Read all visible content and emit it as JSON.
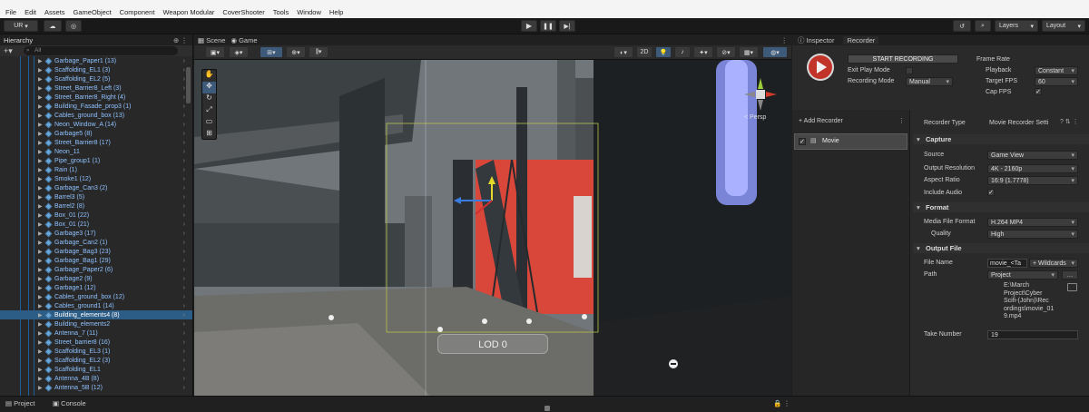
{
  "menu": [
    "File",
    "Edit",
    "Assets",
    "GameObject",
    "Component",
    "Weapon Modular",
    "CoverShooter",
    "Tools",
    "Window",
    "Help"
  ],
  "toolbar": {
    "account": "UR",
    "layers": "Layers",
    "layout": "Layout"
  },
  "hierarchy": {
    "title": "Hierarchy",
    "search_placeholder": "All",
    "items": [
      "Garbage_Paper1 (13)",
      "Scaffolding_EL1 (3)",
      "Scaffolding_EL2 (5)",
      "Street_Barrier8_Left (3)",
      "Street_Barrier8_Right (4)",
      "Building_Fasade_prop3 (1)",
      "Cables_ground_box (13)",
      "Neon_Window_A (14)",
      "Garbage5 (8)",
      "Street_Barrier8 (17)",
      "Neon_11",
      "Pipe_group1 (1)",
      "Rain (1)",
      "Smoke1 (12)",
      "Garbage_Can3 (2)",
      "Barrel3 (5)",
      "Barrel2 (8)",
      "Box_01 (22)",
      "Box_01 (21)",
      "Garbage3 (17)",
      "Garbage_Can2 (1)",
      "Garbage_Bag3 (23)",
      "Garbage_Bag1 (29)",
      "Garbage_Paper2 (6)",
      "Garbage2 (9)",
      "Garbage1 (12)",
      "Cables_ground_box (12)",
      "Cables_ground1 (14)",
      "Building_elements4 (8)",
      "Building_elements2",
      "Antenna_7 (11)",
      "Street_barrier8 (16)",
      "Scaffolding_EL3 (1)",
      "Scaffolding_EL2 (3)",
      "Scaffolding_EL1",
      "Antenna_4B (8)",
      "Antenna_5B (12)"
    ],
    "selected_index": 28
  },
  "scene": {
    "tabs": [
      "Scene",
      "Game"
    ],
    "mode_2d": "2D",
    "persp": "< Persp",
    "lod_label": "LOD 0"
  },
  "inspector": {
    "tabs": [
      "Inspector",
      "Recorder"
    ],
    "start_recording": "START RECORDING",
    "exit_play_mode": "Exit Play Mode",
    "recording_mode_label": "Recording Mode",
    "recording_mode": "Manual",
    "frame_rate_label": "Frame Rate",
    "playback_label": "Playback",
    "playback": "Constant",
    "target_fps_label": "Target FPS",
    "target_fps": "60",
    "cap_fps_label": "Cap FPS",
    "add_recorder": "+ Add Recorder",
    "recorder_item": "Movie",
    "recorder_type_label": "Recorder Type",
    "recorder_type": "Movie Recorder Setti",
    "capture_header": "Capture",
    "source_label": "Source",
    "source": "Game View",
    "resolution_label": "Output Resolution",
    "resolution": "4K - 2160p",
    "aspect_label": "Aspect Ratio",
    "aspect": "16:9 (1.7778)",
    "include_audio_label": "Include Audio",
    "format_header": "Format",
    "media_format_label": "Media File Format",
    "media_format": "H.264 MP4",
    "quality_label": "Quality",
    "quality": "High",
    "output_header": "Output File",
    "filename_label": "File Name",
    "filename": "movie_<Ta",
    "wildcards": "+ Wildcards",
    "path_label": "Path",
    "path": "Project",
    "path_full": [
      "E:\\March",
      "Project\\Cyber",
      "Scifi-(John)\\Rec",
      "ordings\\movie_01",
      "9.mp4"
    ],
    "take_label": "Take Number",
    "take": "19"
  },
  "bottom_tabs": [
    "Project",
    "Console"
  ]
}
